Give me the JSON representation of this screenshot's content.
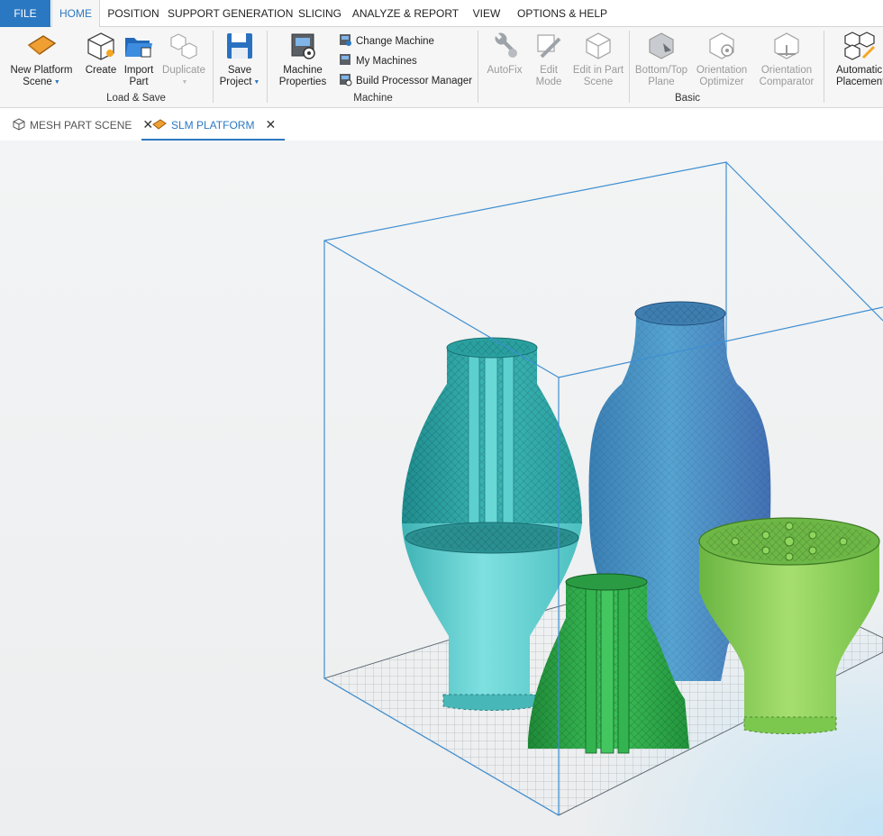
{
  "menu": {
    "file": "FILE",
    "home": "HOME",
    "position": "POSITION",
    "support_generation": "SUPPORT GENERATION",
    "slicing": "SLICING",
    "analyze_report": "ANALYZE & REPORT",
    "view": "VIEW",
    "options_help": "OPTIONS & HELP"
  },
  "ribbon": {
    "new_platform_l1": "New Platform",
    "new_platform_l2": "Scene",
    "create": "Create",
    "import_l1": "Import",
    "import_l2": "Part",
    "duplicate": "Duplicate",
    "save_l1": "Save",
    "save_l2": "Project",
    "machine_props_l1": "Machine",
    "machine_props_l2": "Properties",
    "change_machine": "Change Machine",
    "my_machines": "My Machines",
    "build_processor": "Build Processor Manager",
    "autofix": "AutoFix",
    "edit_mode_l1": "Edit",
    "edit_mode_l2": "Mode",
    "edit_part_l1": "Edit in Part",
    "edit_part_l2": "Scene",
    "bottom_top_l1": "Bottom/Top",
    "bottom_top_l2": "Plane",
    "orient_opt_l1": "Orientation",
    "orient_opt_l2": "Optimizer",
    "orient_comp_l1": "Orientation",
    "orient_comp_l2": "Comparator",
    "auto_place_l1": "Automatic",
    "auto_place_l2": "Placement",
    "groups": {
      "load_save": "Load & Save",
      "machine": "Machine",
      "basic": "Basic"
    }
  },
  "doc_tabs": {
    "mesh_part_scene": "MESH PART SCENE",
    "slm_platform": "SLM PLATFORM",
    "close": "✕"
  },
  "colors": {
    "accent": "#2b78c2",
    "build_box": "#3f8fd2",
    "part_teal": "#5ccfd0",
    "part_blue": "#3d8cc4",
    "part_green": "#2ea84a",
    "part_lime": "#8ccf5a"
  },
  "icons": [
    "platform-icon",
    "create-cube-icon",
    "folder-icon",
    "duplicate-icon",
    "save-icon",
    "machine-icon",
    "wrench-icon",
    "edit-icon",
    "cube-edit-icon",
    "plane-icon",
    "orientation-icon",
    "comparator-icon",
    "placement-icon",
    "close-icon"
  ]
}
